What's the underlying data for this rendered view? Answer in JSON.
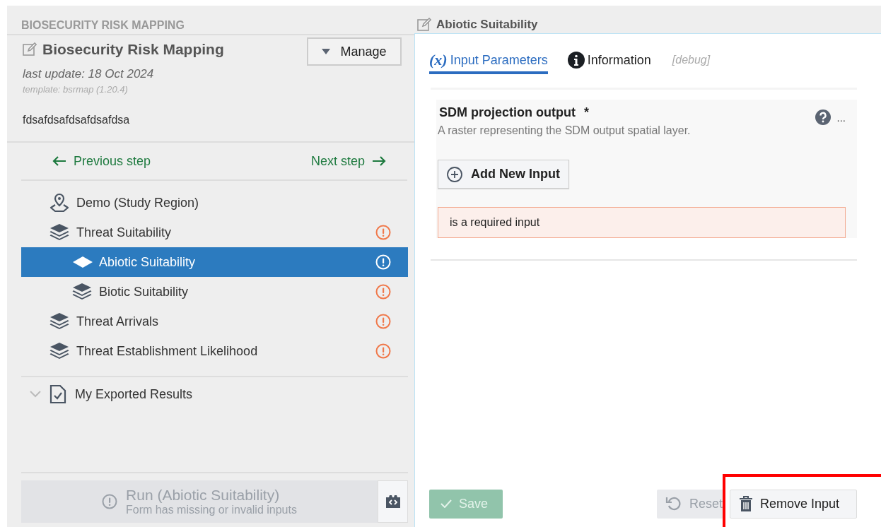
{
  "sidebar": {
    "section_title": "BIOSECURITY RISK MAPPING",
    "project": {
      "name": "Biosecurity Risk Mapping",
      "manage_button": "Manage",
      "last_update": "last update: 18 Oct 2024",
      "template": "template: bsrmap (1.20.4)",
      "description": "fdsafdsafdsafdsafdsa"
    },
    "navigation": {
      "previous": "Previous step",
      "next": "Next step"
    },
    "steps": [
      {
        "label": "Demo (Study Region)",
        "kind": "region",
        "selected": false,
        "warning": false
      },
      {
        "label": "Threat Suitability",
        "kind": "layers",
        "selected": false,
        "warning": true,
        "children": [
          {
            "label": "Abiotic Suitability",
            "kind": "diamond",
            "selected": true,
            "warning": true
          },
          {
            "label": "Biotic Suitability",
            "kind": "layers",
            "selected": false,
            "warning": true
          }
        ]
      },
      {
        "label": "Threat Arrivals",
        "kind": "layers",
        "selected": false,
        "warning": true
      },
      {
        "label": "Threat Establishment Likelihood",
        "kind": "layers",
        "selected": false,
        "warning": true
      }
    ],
    "exported": {
      "label": "My Exported Results",
      "expanded": true
    },
    "run": {
      "label": "Run (Abiotic Suitability)",
      "hint": "Form has missing or invalid inputs",
      "disabled": true
    }
  },
  "detail": {
    "title": "Abiotic Suitability",
    "tabs": [
      {
        "label": "Input Parameters",
        "kind": "function",
        "glyph": "(x)",
        "selected": true
      },
      {
        "label": "Information",
        "kind": "info",
        "selected": false
      },
      {
        "label": "[debug]",
        "kind": "debug",
        "selected": false
      }
    ],
    "parameter": {
      "name": "SDM projection output",
      "required_mark": "*",
      "description": "A raster representing the SDM output spatial layer.",
      "more": "...",
      "add_button": "Add New Input",
      "error": "is a required input"
    },
    "buttons": [
      {
        "label": "Save",
        "kind": "save",
        "disabled": true
      },
      {
        "label": "Reset",
        "kind": "reset",
        "disabled": true
      },
      {
        "label": "Remove Input",
        "kind": "remove",
        "disabled": false
      }
    ]
  }
}
